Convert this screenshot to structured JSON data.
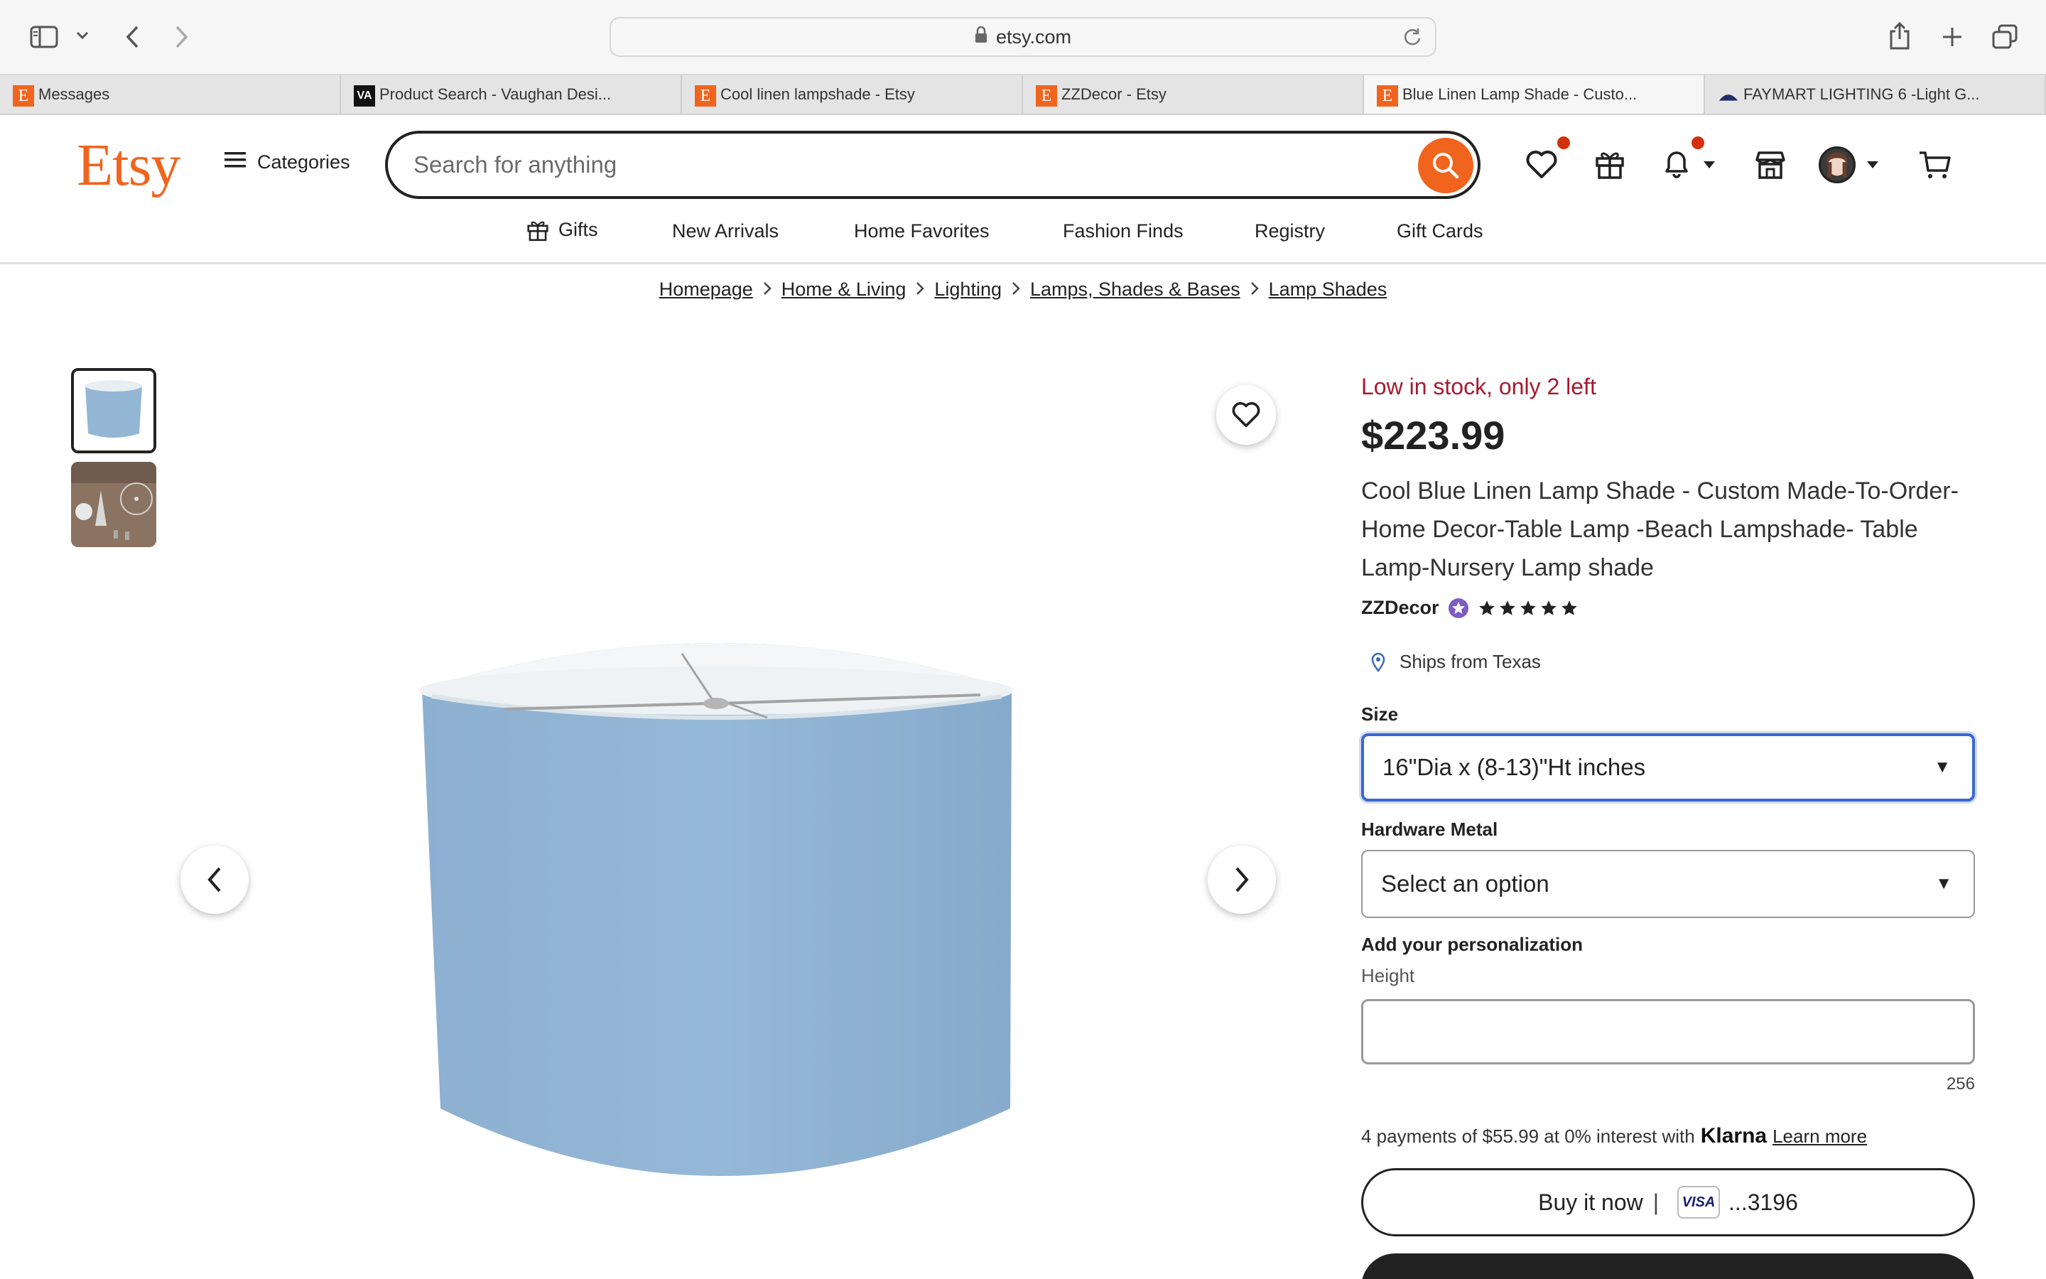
{
  "browser": {
    "url": "etsy.com",
    "tabs": [
      {
        "title": "Messages",
        "favicon": "etsy-favicon"
      },
      {
        "title": "Product Search - Vaughan Desi...",
        "favicon": "va-favicon"
      },
      {
        "title": "Cool linen lampshade - Etsy",
        "favicon": "etsy-favicon"
      },
      {
        "title": "ZZDecor - Etsy",
        "favicon": "etsy-favicon"
      },
      {
        "title": "Blue Linen Lamp Shade - Custo...",
        "favicon": "etsy-favicon",
        "active": true
      },
      {
        "title": "FAYMART LIGHTING 6 -Light G...",
        "favicon": "faymart-favicon"
      }
    ]
  },
  "header": {
    "logo": "Etsy",
    "categories_label": "Categories",
    "search_placeholder": "Search for anything"
  },
  "nav": {
    "items": [
      "Gifts",
      "New Arrivals",
      "Home Favorites",
      "Fashion Finds",
      "Registry",
      "Gift Cards"
    ]
  },
  "breadcrumb": [
    "Homepage",
    "Home & Living",
    "Lighting",
    "Lamps, Shades & Bases",
    "Lamp Shades"
  ],
  "product": {
    "stock_text": "Low in stock, only 2 left",
    "price": "$223.99",
    "title": "Cool Blue Linen Lamp Shade - Custom Made-To-Order-Home Decor-Table Lamp -Beach Lampshade- Table Lamp-Nursery Lamp shade",
    "shop_name": "ZZDecor",
    "rating": 5,
    "ships_from": "Ships from Texas",
    "size_label": "Size",
    "size_value": "16\"Dia x (8-13)\"Ht inches",
    "hardware_label": "Hardware Metal",
    "hardware_value": "Select an option",
    "personalization_label": "Add your personalization",
    "personalization_sublabel": "Height",
    "personalization_count": "256",
    "klarna_text": "4 payments of $55.99 at 0% interest with",
    "klarna_brand": "Klarna",
    "klarna_link": "Learn more",
    "buy_now_label": "Buy it now",
    "card_brand": "VISA",
    "card_last4": "...3196"
  },
  "colors": {
    "brand": "#f1641e",
    "stock": "#a61a2e",
    "focus": "#3b67d2",
    "shade_blue": "#8fb4d4"
  }
}
